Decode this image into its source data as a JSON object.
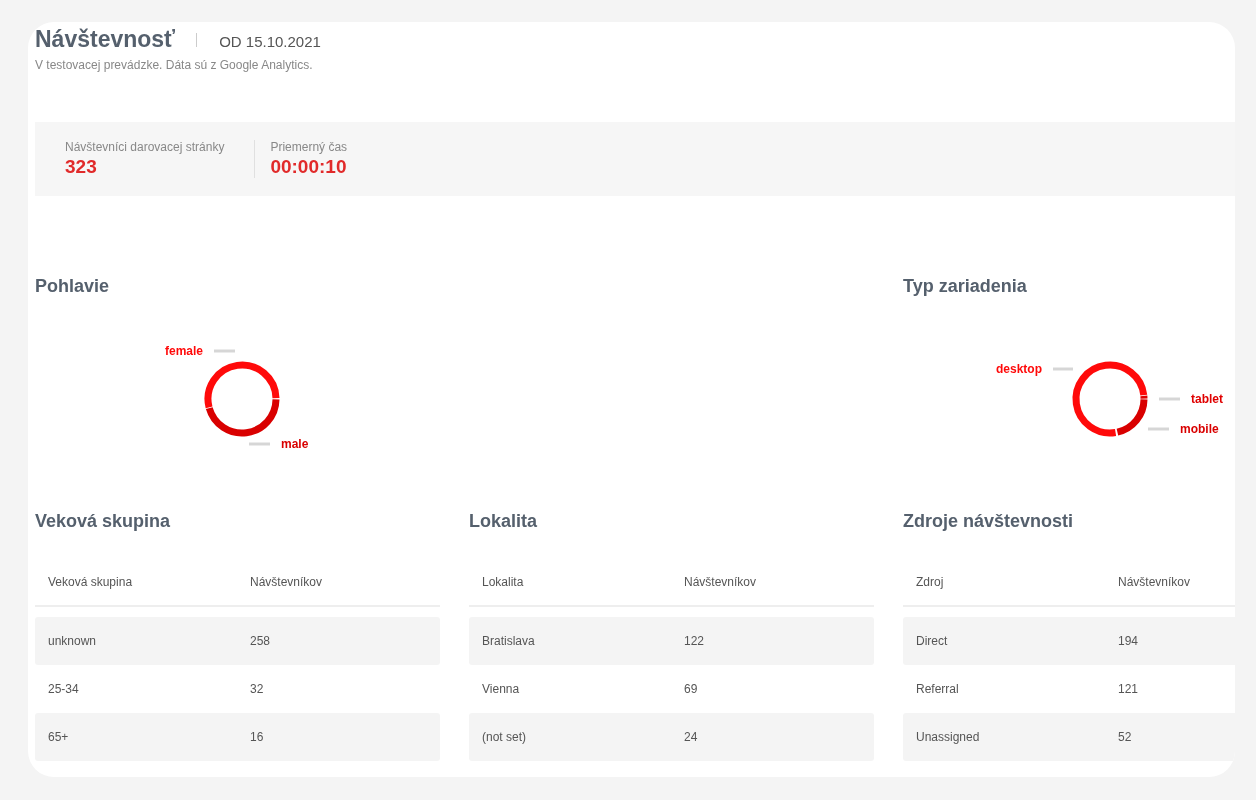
{
  "header": {
    "title": "Návštevnosť",
    "date": "OD 15.10.2021",
    "subtitle": "V testovacej prevádzke. Dáta sú z Google Analytics."
  },
  "stats": [
    {
      "label": "Návštevníci darovacej stránky",
      "value": "323"
    },
    {
      "label": "Priemerný čas",
      "value": "00:00:10"
    }
  ],
  "donuts": [
    {
      "title": "Pohlavie",
      "segments": [
        {
          "label": "male",
          "color": "#d90000"
        },
        {
          "label": "female",
          "color": "#ff0a0a"
        }
      ]
    },
    {
      "title": "Typ zariadenia",
      "segments": [
        {
          "label": "mobile",
          "color": "#d90000"
        },
        {
          "label": "desktop",
          "color": "#ff0a0a"
        },
        {
          "label": "tablet",
          "color": "#e00000"
        }
      ]
    }
  ],
  "tables": [
    {
      "title": "Veková skupina",
      "columns": [
        "Veková skupina",
        "Návštevníkov"
      ],
      "rows": [
        [
          "unknown",
          "258"
        ],
        [
          "25-34",
          "32"
        ],
        [
          "65+",
          "16"
        ]
      ]
    },
    {
      "title": "Lokalita",
      "columns": [
        "Lokalita",
        "Návštevníkov"
      ],
      "rows": [
        [
          "Bratislava",
          "122"
        ],
        [
          "Vienna",
          "69"
        ],
        [
          "(not set)",
          "24"
        ]
      ]
    },
    {
      "title": "Zdroje návštevnosti",
      "columns": [
        "Zdroj",
        "Návštevníkov"
      ],
      "rows": [
        [
          "Direct",
          "194"
        ],
        [
          "Referral",
          "121"
        ],
        [
          "Unassigned",
          "52"
        ]
      ]
    }
  ]
}
